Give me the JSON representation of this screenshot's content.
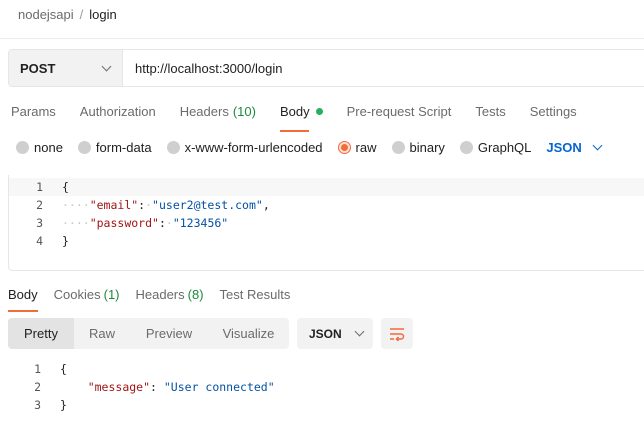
{
  "breadcrumb": {
    "collection": "nodejsapi",
    "separator": "/",
    "request": "login"
  },
  "request": {
    "method": "POST",
    "url": "http://localhost:3000/login"
  },
  "request_tabs": [
    {
      "label": "Params"
    },
    {
      "label": "Authorization"
    },
    {
      "label": "Headers",
      "count": "(10)"
    },
    {
      "label": "Body",
      "active": true
    },
    {
      "label": "Pre-request Script"
    },
    {
      "label": "Tests"
    },
    {
      "label": "Settings"
    }
  ],
  "body_types": {
    "options": [
      "none",
      "form-data",
      "x-www-form-urlencoded",
      "raw",
      "binary",
      "GraphQL"
    ],
    "selected": "raw",
    "language": "JSON"
  },
  "request_body": {
    "line_numbers": [
      "1",
      "2",
      "3",
      "4"
    ],
    "open_brace": "{",
    "close_brace": "}",
    "fields": [
      {
        "key": "\"email\"",
        "value": "\"user2@test.com\""
      },
      {
        "key": "\"password\"",
        "value": "\"123456\""
      }
    ]
  },
  "response_tabs": [
    {
      "label": "Body",
      "active": true
    },
    {
      "label": "Cookies",
      "count": "(1)"
    },
    {
      "label": "Headers",
      "count": "(8)"
    },
    {
      "label": "Test Results"
    }
  ],
  "response_views": [
    "Pretty",
    "Raw",
    "Preview",
    "Visualize"
  ],
  "response_format": "JSON",
  "response_body": {
    "line_numbers": [
      "1",
      "2",
      "3"
    ],
    "open_brace": "{",
    "close_brace": "}",
    "key": "\"message\"",
    "value": "\"User connected\""
  },
  "colors": {
    "accent": "#f26b3a",
    "link_blue": "#0265d2",
    "count_green": "#1c8a3a",
    "json_key": "#a31515",
    "json_string": "#0451a5"
  }
}
